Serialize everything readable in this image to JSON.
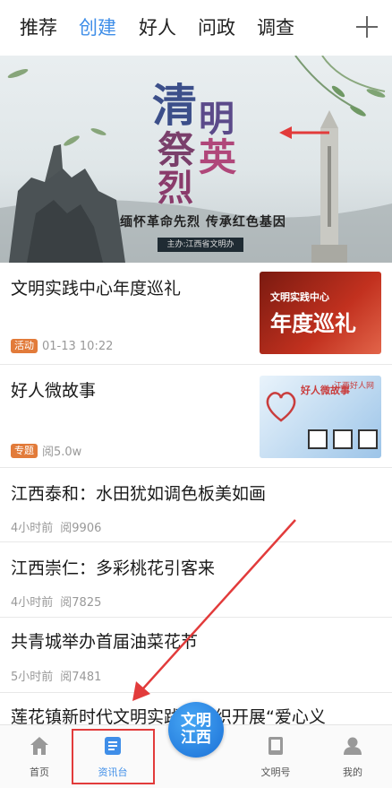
{
  "top_tabs": [
    {
      "label": "推荐"
    },
    {
      "label": "创建"
    },
    {
      "label": "好人"
    },
    {
      "label": "问政"
    },
    {
      "label": "调查"
    }
  ],
  "banner": {
    "headline_chars": [
      "清",
      "明",
      "祭",
      "英",
      "烈"
    ],
    "subtitle": "缅怀革命先烈  传承红色基因",
    "host": "主办:江西省文明办"
  },
  "feed": [
    {
      "title": "文明实践中心年度巡礼",
      "badge": "活动",
      "meta": "01-13 10:22",
      "thumb": {
        "line1": "文明实践中心",
        "line2": "年度巡礼"
      }
    },
    {
      "title": "好人微故事",
      "badge": "专题",
      "meta": "阅5.0w",
      "thumb": {
        "line1": "好人微故事",
        "line2": "江西好人网"
      }
    },
    {
      "title": "江西泰和：水田犹如调色板美如画",
      "time": "4小时前",
      "reads": "阅9906"
    },
    {
      "title": "江西崇仁：多彩桃花引客来",
      "time": "4小时前",
      "reads": "阅7825"
    },
    {
      "title": "共青城举办首届油菜花节",
      "time": "5小时前",
      "reads": "阅7481"
    },
    {
      "title": "莲花镇新时代文明实践所组织开展“爱心义"
    }
  ],
  "bottom_nav": [
    {
      "label": "首页",
      "icon": "home-icon"
    },
    {
      "label": "资讯台",
      "icon": "news-icon"
    },
    {
      "label": "文明号",
      "icon": "book-icon"
    },
    {
      "label": "我的",
      "icon": "user-icon"
    }
  ],
  "center_button": {
    "line1": "文明",
    "line2": "江西"
  },
  "colors": {
    "accent": "#3f8ee8",
    "badge": "#e27b3a",
    "annotation_red": "#e23b3b"
  }
}
